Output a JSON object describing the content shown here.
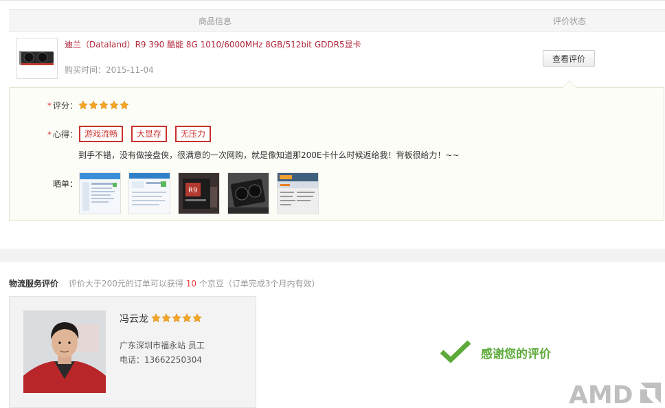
{
  "header": {
    "product_info_label": "商品信息",
    "review_status_label": "评价状态"
  },
  "product": {
    "title": "迪兰（Dataland）R9 390 酷能 8G 1010/6000MHz 8GB/512bit GDDR5显卡",
    "purchase_time": "购买时间：2015-11-04",
    "view_review_button": "查看评价"
  },
  "review": {
    "required_mark": "*",
    "score_label": "评分：",
    "score_stars": 5,
    "experience_label": "心得：",
    "tags": [
      "游戏流畅",
      "大显存",
      "无压力"
    ],
    "content": "到手不错，没有做接盘侠，很满意的一次网购，就是像知道那200E卡什么时候返给我！背板很给力！~~",
    "photos_label": "晒单：",
    "photos_count": 5
  },
  "logistics": {
    "title": "物流服务评价",
    "desc_prefix": "评价大于200元的订单可以获得",
    "desc_number": "10",
    "desc_suffix": "个京豆（订单完成3个月内有效）",
    "courier": {
      "name": "冯云龙",
      "stars": 5,
      "station": "广东深圳市福永站 员工",
      "phone": "电话：13662250304"
    },
    "thanks": "感谢您的评价"
  },
  "colors": {
    "accent_red": "#e4393c",
    "tag_red": "#c8312e",
    "star_gold": "#f5a623",
    "thanks_green": "#5caa3a"
  }
}
